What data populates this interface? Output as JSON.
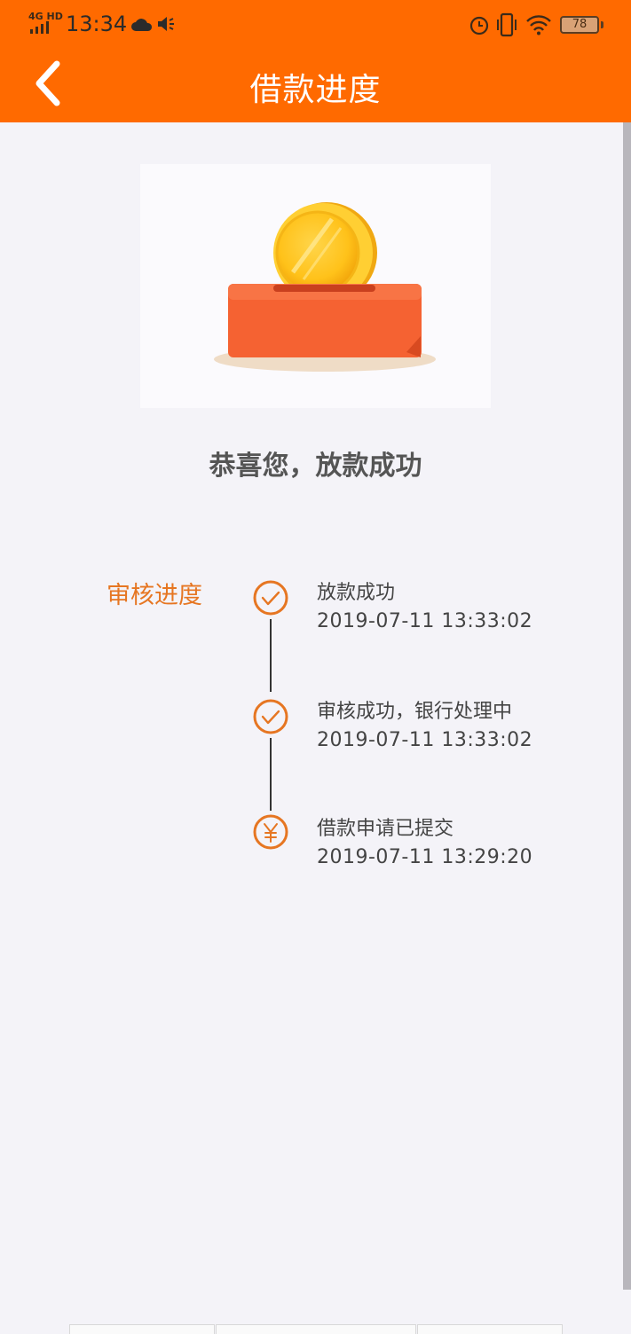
{
  "status_bar": {
    "network": "4G HD",
    "time": "13:34",
    "battery": "78",
    "icons": [
      "signal-icon",
      "cloud-icon",
      "speaker-icon",
      "alarm-icon",
      "vibrate-icon",
      "wifi-icon",
      "battery-icon"
    ]
  },
  "header": {
    "title": "借款进度",
    "back_icon": "chevron-left-icon"
  },
  "hero": {
    "illustration": "coin-piggybank-illustration",
    "message": "恭喜您，放款成功"
  },
  "progress": {
    "label": "审核进度",
    "steps": [
      {
        "title": "放款成功",
        "time": "2019-07-11 13:33:02",
        "icon": "check-circle-icon"
      },
      {
        "title": "审核成功，银行处理中",
        "time": "2019-07-11 13:33:02",
        "icon": "check-circle-icon"
      },
      {
        "title": "借款申请已提交",
        "time": "2019-07-11 13:29:20",
        "icon": "yuan-circle-icon"
      }
    ]
  },
  "colors": {
    "header_bg": "#ff6a00",
    "accent": "#e67622",
    "page_bg": "#f4f3f8"
  }
}
